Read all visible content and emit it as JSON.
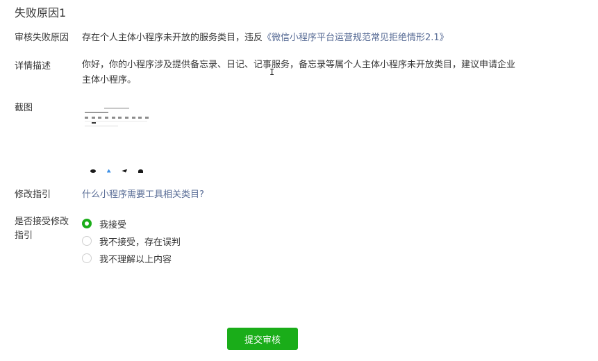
{
  "section": {
    "title": "失败原因1"
  },
  "reason": {
    "label": "审核失败原因",
    "text": "存在个人主体小程序未开放的服务类目，违反",
    "link": "《微信小程序平台运营规范常见拒绝情形2.1》"
  },
  "detail": {
    "label": "详情描述",
    "text": "你好，你的小程序涉及提供备忘录、日记、记事服务，备忘录等属个人主体小程序未开放类目，建议申请企业主体小程序。"
  },
  "screenshot": {
    "label": "截图",
    "thumbnail_icon": "screenshot-thumbnail"
  },
  "guide": {
    "label": "修改指引",
    "link": "什么小程序需要工具相关类目?"
  },
  "accept": {
    "label": "是否接受修改指引",
    "options": [
      {
        "label": "我接受",
        "selected": true
      },
      {
        "label": "我不接受，存在误判",
        "selected": false
      },
      {
        "label": "我不理解以上内容",
        "selected": false
      }
    ]
  },
  "actions": {
    "submit_label": "提交审核"
  },
  "colors": {
    "accent": "#1aad19",
    "link": "#576b95",
    "text": "#353535"
  },
  "cursor_glyph": "I"
}
